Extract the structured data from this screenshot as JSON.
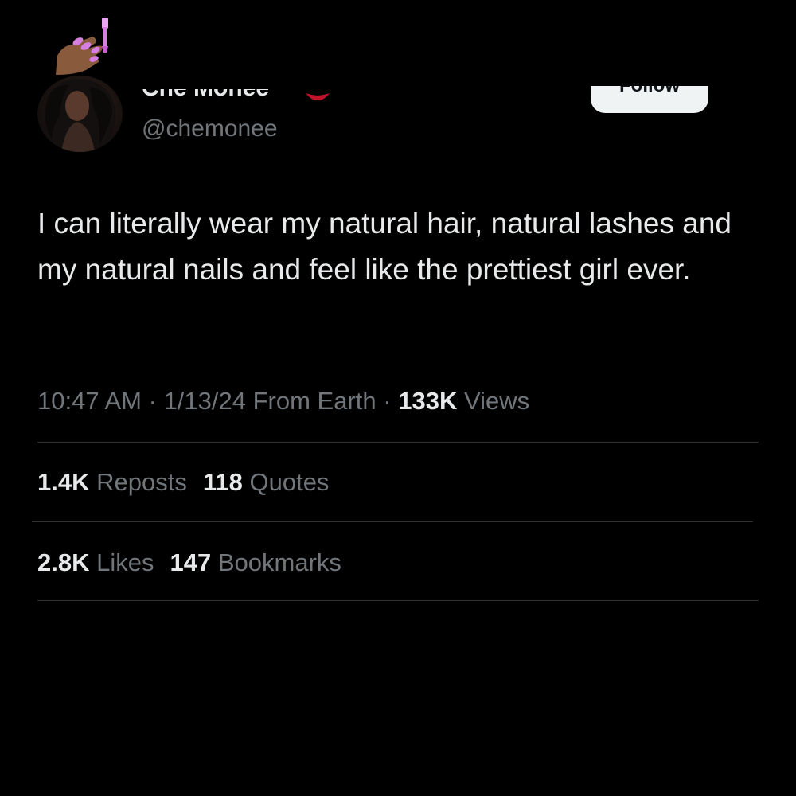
{
  "header": {
    "overlay_emoji": "nail-polish-icon",
    "display_name_partial": "Che Monee",
    "display_name_emoji": "lips-icon",
    "handle": "@chemonee",
    "follow_label": "Follow"
  },
  "tweet": {
    "text": "I can literally wear my natural hair, natural lashes and my natural nails and feel like the prettiest girl ever.",
    "time": "10:47 AM",
    "date": "1/13/24",
    "source": "From Earth",
    "sep": "·",
    "views_count": "133K",
    "views_label": "Views"
  },
  "stats": {
    "reposts_count": "1.4K",
    "reposts_label": "Reposts",
    "quotes_count": "118",
    "quotes_label": "Quotes",
    "likes_count": "2.8K",
    "likes_label": "Likes",
    "bookmarks_count": "147",
    "bookmarks_label": "Bookmarks"
  },
  "colors": {
    "background": "#000000",
    "primary_text": "#e7e9ea",
    "secondary_text": "#71767b",
    "divider": "#2f3336",
    "nail_polish": "#d77fe0"
  }
}
